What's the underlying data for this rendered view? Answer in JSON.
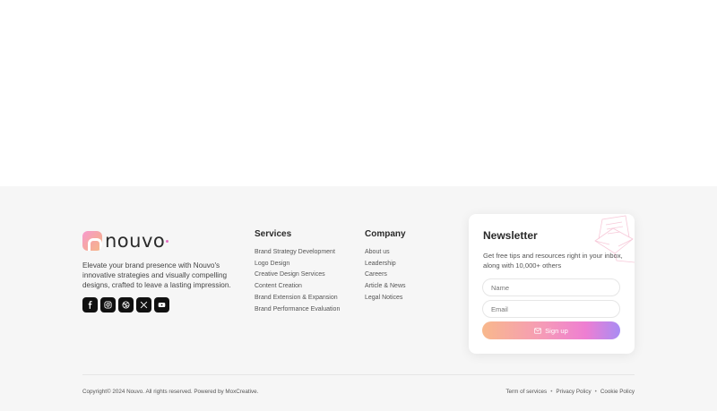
{
  "brand": {
    "name": "nouvo",
    "description": "Elevate your brand presence with Nouvo's innovative strategies and visually compelling designs, crafted to leave a lasting impression.",
    "accent_color": "#e46fc2",
    "socials": [
      "facebook-icon",
      "instagram-icon",
      "dribbble-icon",
      "x-icon",
      "youtube-icon"
    ]
  },
  "services": {
    "title": "Services",
    "items": [
      "Brand Strategy Development",
      "Logo Design",
      "Creative Design Services",
      "Content Creation",
      "Brand Extension & Expansion",
      "Brand Performance Evaluation"
    ]
  },
  "company": {
    "title": "Company",
    "items": [
      "About us",
      "Leadership",
      "Careers",
      "Article & News",
      "Legal Notices"
    ]
  },
  "newsletter": {
    "title": "Newsletter",
    "description": "Get free tips and resources right in your inbox, along with 10,000+ others",
    "name_placeholder": "Name",
    "email_placeholder": "Email",
    "button_label": "Sign up",
    "button_icon": "mail-icon"
  },
  "bottom": {
    "copyright": "Copyright© 2024 Nouvo. All rights reserved. Powered by MoxCreative.",
    "links": [
      "Term of services",
      "Privacy Policy",
      "Cookie Policy"
    ],
    "separator": "•"
  }
}
